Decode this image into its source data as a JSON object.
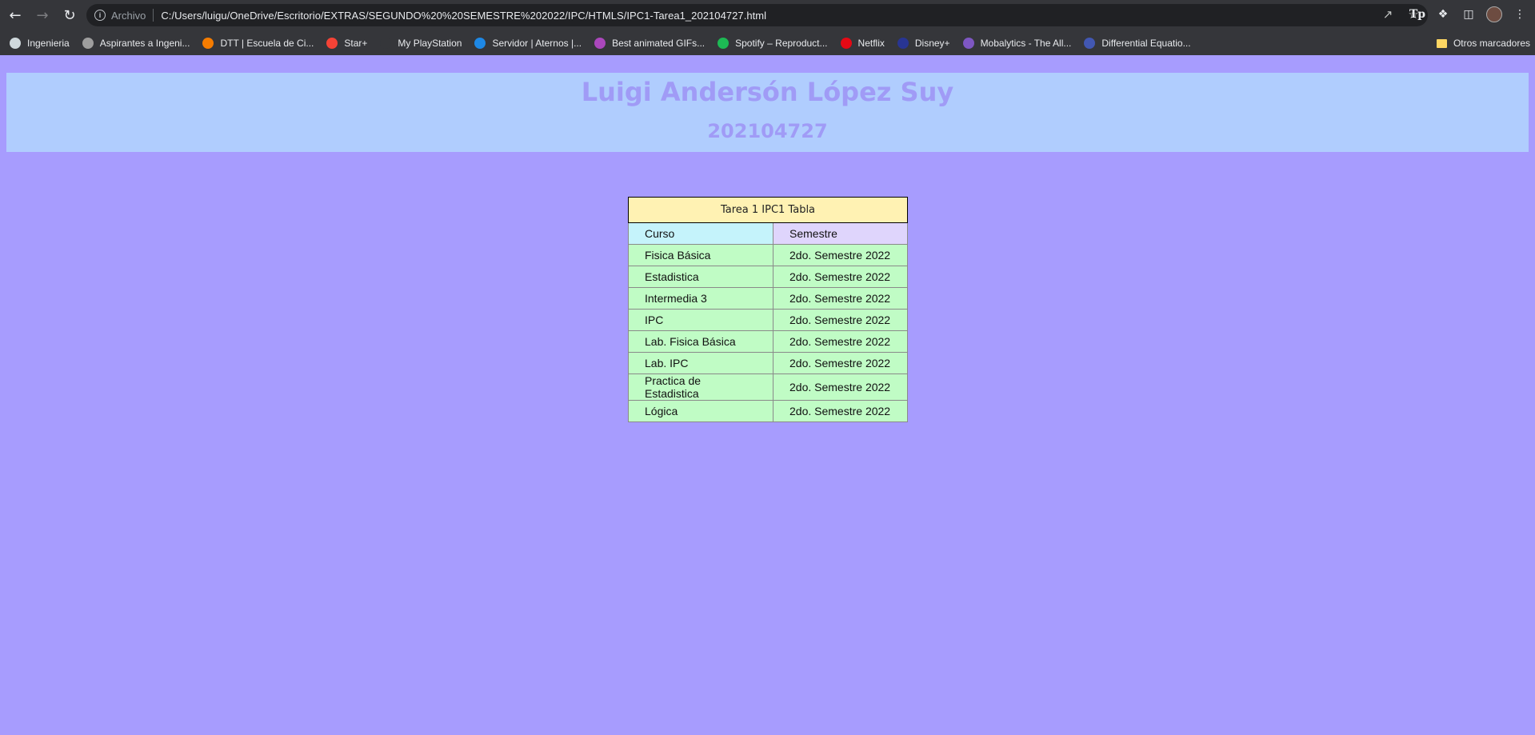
{
  "browser": {
    "scheme_label": "Archivo",
    "url": "C:/Users/luigu/OneDrive/Escritorio/EXTRAS/SEGUNDO%20%20SEMESTRE%202022/IPC/HTMLS/IPC1-Tarea1_202104727.html",
    "bookmarks": [
      {
        "label": "Ingenieria",
        "icon": "globe-icon",
        "color": "#cfd8dc"
      },
      {
        "label": "Aspirantes a Ingeni...",
        "icon": "globe-icon",
        "color": "#9e9e9e"
      },
      {
        "label": "DTT | Escuela de Ci...",
        "icon": "dtt-icon",
        "color": "#f57c00"
      },
      {
        "label": "Star+",
        "icon": "star-icon",
        "color": "#f44336"
      },
      {
        "label": "My PlayStation",
        "icon": "playstation-icon",
        "color": "#35363a"
      },
      {
        "label": "Servidor | Aternos |...",
        "icon": "aternos-icon",
        "color": "#1e88e5"
      },
      {
        "label": "Best animated GIFs...",
        "icon": "gif-icon",
        "color": "#ab47bc"
      },
      {
        "label": "Spotify – Reproduct...",
        "icon": "spotify-icon",
        "color": "#1db954"
      },
      {
        "label": "Netflix",
        "icon": "netflix-icon",
        "color": "#e50914"
      },
      {
        "label": "Disney+",
        "icon": "disney-icon",
        "color": "#283593"
      },
      {
        "label": "Mobalytics - The All...",
        "icon": "mobalytics-icon",
        "color": "#7e57c2"
      },
      {
        "label": "Differential Equatio...",
        "icon": "quizlet-icon",
        "color": "#4257b2"
      }
    ],
    "other_bookmarks": "Otros marcadores"
  },
  "page": {
    "name": "Luigi Andersón López Suy",
    "carnet": "202104727",
    "table": {
      "caption": "Tarea 1 IPC1 Tabla",
      "headers": [
        "Curso",
        "Semestre"
      ],
      "rows": [
        [
          "Fisica Básica",
          "2do. Semestre 2022"
        ],
        [
          "Estadistica",
          "2do. Semestre 2022"
        ],
        [
          "Intermedia 3",
          "2do. Semestre 2022"
        ],
        [
          "IPC",
          "2do. Semestre 2022"
        ],
        [
          "Lab. Fisica Básica",
          "2do. Semestre 2022"
        ],
        [
          "Lab. IPC",
          "2do. Semestre 2022"
        ],
        [
          "Practica de Estadistica",
          "2do. Semestre 2022"
        ],
        [
          "Lógica",
          "2do. Semestre 2022"
        ]
      ]
    }
  },
  "colors": {
    "page_bg": "#a79cfe",
    "header_bg": "#b0cdfe",
    "header_text": "#a09bf6",
    "caption_bg": "#fff2b3",
    "curso_header_bg": "#c5f3fb",
    "semestre_header_bg": "#dfd5fc",
    "row_bg": "#c0fcc5"
  }
}
